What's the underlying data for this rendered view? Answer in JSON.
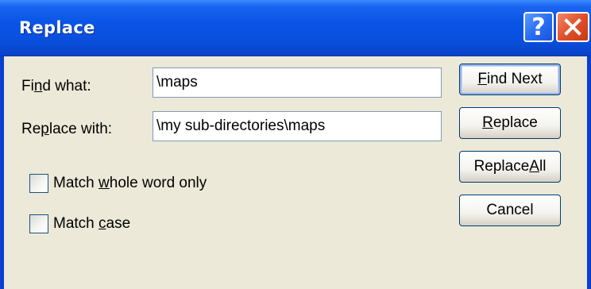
{
  "window": {
    "title": "Replace",
    "help_glyph": "?",
    "close_icon": "close-icon"
  },
  "find": {
    "label_pre": "Fi",
    "label_key": "n",
    "label_post": "d what:",
    "value": "\\maps"
  },
  "replace": {
    "label_pre": "Re",
    "label_key": "p",
    "label_post": "lace with:",
    "value": "\\my sub-directories\\maps"
  },
  "options": {
    "whole_word": {
      "label_pre": "Match ",
      "label_key": "w",
      "label_post": "hole word only",
      "checked": false
    },
    "match_case": {
      "label_pre": "Match ",
      "label_key": "c",
      "label_post": "ase",
      "checked": false
    }
  },
  "buttons": {
    "find_next": {
      "pre": "",
      "key": "F",
      "post": "ind Next"
    },
    "replace": {
      "pre": "",
      "key": "R",
      "post": "eplace"
    },
    "replace_all": {
      "pre": "Replace ",
      "key": "A",
      "post": "ll"
    },
    "cancel": {
      "label": "Cancel"
    }
  },
  "colors": {
    "titlebar": "#0a55e6",
    "dialog_bg": "#ece9d8",
    "close_button": "#e0502a",
    "help_button": "#2a6ef5"
  }
}
